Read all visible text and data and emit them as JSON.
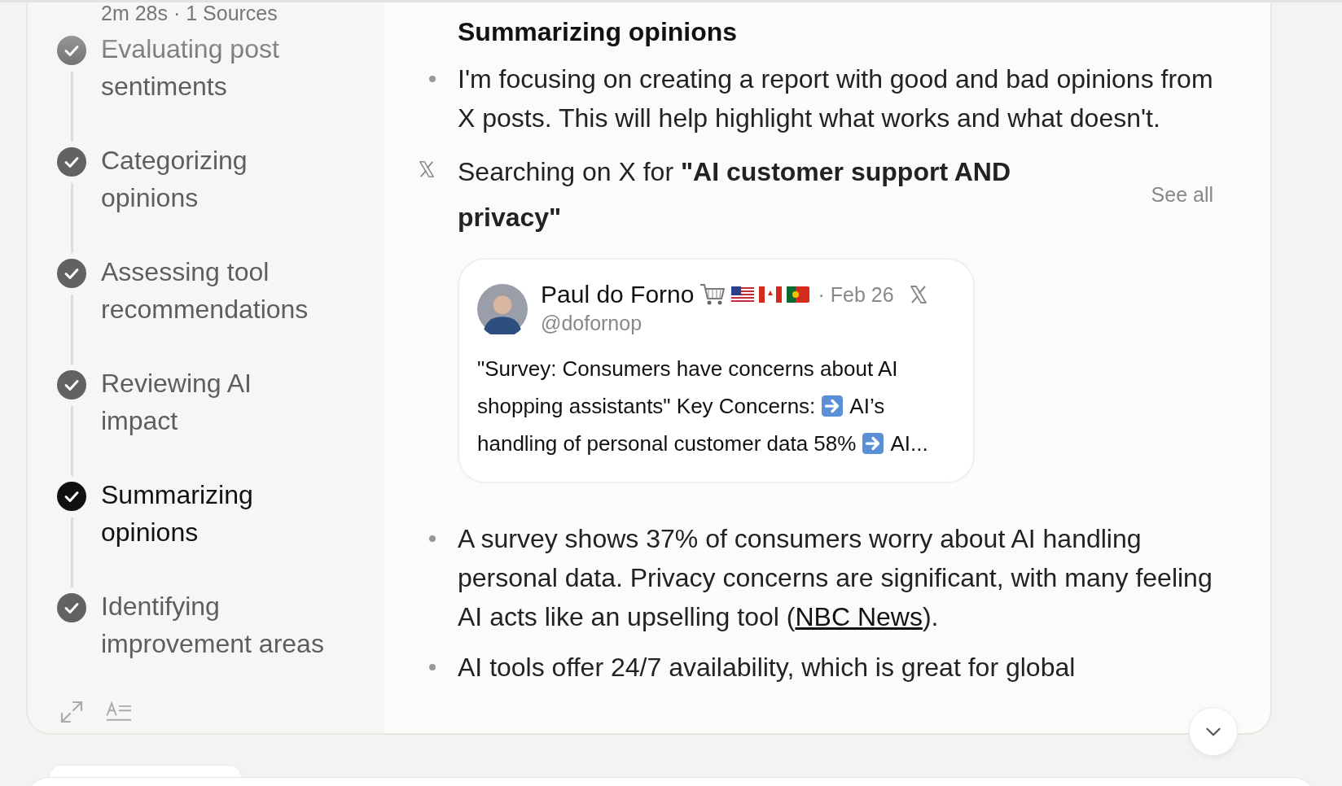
{
  "meta": "2m 28s · 1 Sources",
  "steps": [
    {
      "label": "Evaluating post sentiments",
      "selected": false
    },
    {
      "label": "Categorizing opinions",
      "selected": false
    },
    {
      "label": "Assessing tool recommendations",
      "selected": false
    },
    {
      "label": "Reviewing AI impact",
      "selected": false
    },
    {
      "label": "Summarizing opinions",
      "selected": true
    },
    {
      "label": "Identifying improvement areas",
      "selected": false
    }
  ],
  "heading": "Summarizing opinions",
  "content": [
    {
      "kind": "bullet",
      "parts": [
        {
          "text": "I'm focusing on creating a report with good and bad opinions from X posts. This will help highlight what works and what doesn't."
        }
      ]
    },
    {
      "kind": "search",
      "text": "Searching on X for **\"AI customer support AND privacy\"**",
      "action": "See all"
    },
    {
      "kind": "post",
      "author": "Paul do Forno",
      "date": "· Feb 26",
      "handle": "@dofornop",
      "body": [
        [
          {
            "kind": "text",
            "text": "\"Survey: Consumers have concerns about AI"
          }
        ],
        [
          {
            "kind": "text",
            "text": "shopping assistants\" Key Concerns:"
          },
          {
            "kind": "arrow"
          },
          {
            "kind": "text",
            "text": "AI’s"
          }
        ],
        [
          {
            "kind": "text",
            "text": "handling of personal customer data 58%"
          },
          {
            "kind": "arrow"
          },
          {
            "kind": "text",
            "text": "AI..."
          }
        ]
      ]
    },
    {
      "kind": "bullet",
      "parts": [
        {
          "kind": "text",
          "text": "A survey shows 37% of consumers worry about AI handling personal data. Privacy concerns are significant, with many feeling AI acts like an upselling tool ("
        },
        {
          "kind": "link",
          "text": "NBC News"
        },
        {
          "kind": "text",
          "text": ")."
        }
      ]
    },
    {
      "kind": "bullet",
      "parts": [
        {
          "text": "AI tools offer 24/7 availability, which is great for global"
        }
      ]
    }
  ]
}
